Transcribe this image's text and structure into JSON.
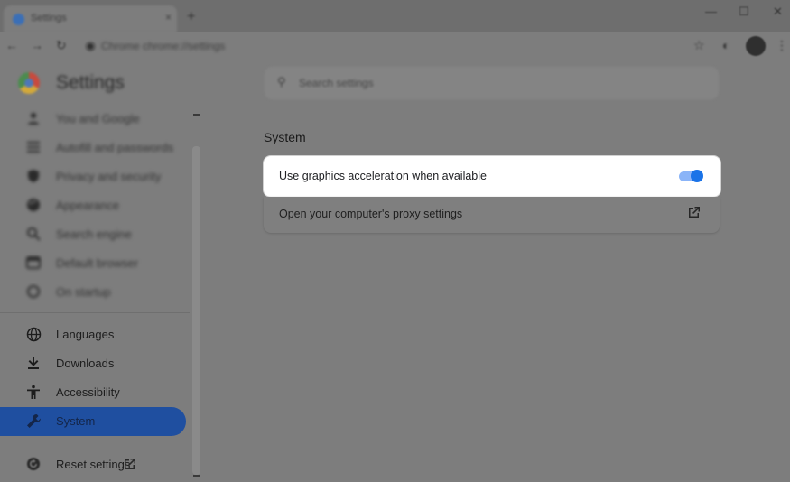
{
  "browser": {
    "tab_title": "Settings",
    "tab_close": "×",
    "new_tab": "+",
    "window_controls": {
      "minimize": "—",
      "maximize": "☐",
      "close": "✕"
    },
    "address": "Chrome  chrome://settings"
  },
  "header": {
    "title": "Settings",
    "search_placeholder": "Search settings"
  },
  "sidebar": {
    "items": [
      {
        "label": "You and Google",
        "icon": "person-icon",
        "state": "blurred"
      },
      {
        "label": "Autofill and passwords",
        "icon": "list-icon",
        "state": "blurred"
      },
      {
        "label": "Privacy and security",
        "icon": "shield-icon",
        "state": "blurred"
      },
      {
        "label": "Appearance",
        "icon": "palette-icon",
        "state": "blurred"
      },
      {
        "label": "Search engine",
        "icon": "search-icon",
        "state": "blurred"
      },
      {
        "label": "Default browser",
        "icon": "browser-icon",
        "state": "blurred"
      },
      {
        "label": "On startup",
        "icon": "power-icon",
        "state": "blurred"
      },
      {
        "label": "Languages",
        "icon": "globe-icon",
        "state": "normal"
      },
      {
        "label": "Downloads",
        "icon": "download-icon",
        "state": "normal"
      },
      {
        "label": "Accessibility",
        "icon": "accessibility-icon",
        "state": "normal"
      },
      {
        "label": "System",
        "icon": "wrench-icon",
        "state": "active"
      },
      {
        "label": "Reset settings",
        "icon": "reset-icon",
        "state": "normal"
      }
    ]
  },
  "main": {
    "section_title": "System",
    "rows": [
      {
        "label": "Use graphics acceleration when available",
        "toggle_on": true
      },
      {
        "label": "Open your computer's proxy settings",
        "icon": "external-link-icon"
      }
    ]
  },
  "colors": {
    "accent": "#1a73e8",
    "active_nav": "#1f4fa0",
    "overlay": "#7d7d7d"
  }
}
